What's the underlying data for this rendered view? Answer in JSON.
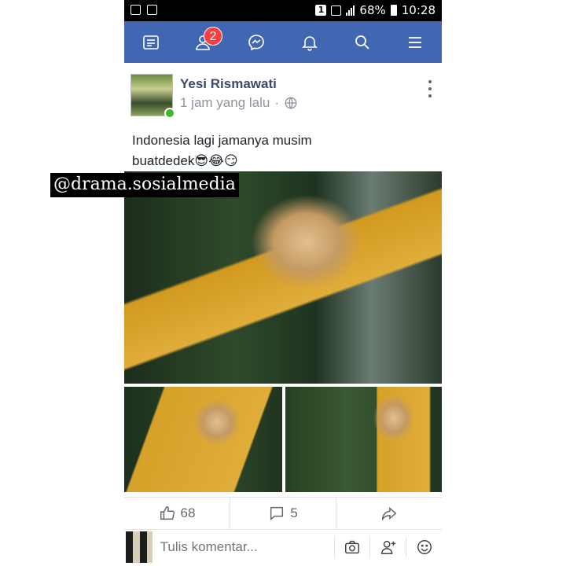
{
  "status_bar": {
    "badge": "1",
    "battery": "68%",
    "time": "10:28"
  },
  "navbar": {
    "items": [
      "news-feed-icon",
      "friend-requests-icon",
      "messenger-icon",
      "notifications-icon",
      "search-icon",
      "menu-icon"
    ],
    "friend_requests_count": "2",
    "color": "#4267b2"
  },
  "post": {
    "author": "Yesi Rismawati",
    "time": "1 jam yang lalu",
    "separator": "·",
    "text": "Indonesia lagi jamanya musim\nbuatdedek😎😂😏",
    "likes": "68",
    "comments": "5"
  },
  "watermark": "@drama.sosialmedia",
  "comment_bar": {
    "placeholder": "Tulis komentar..."
  }
}
